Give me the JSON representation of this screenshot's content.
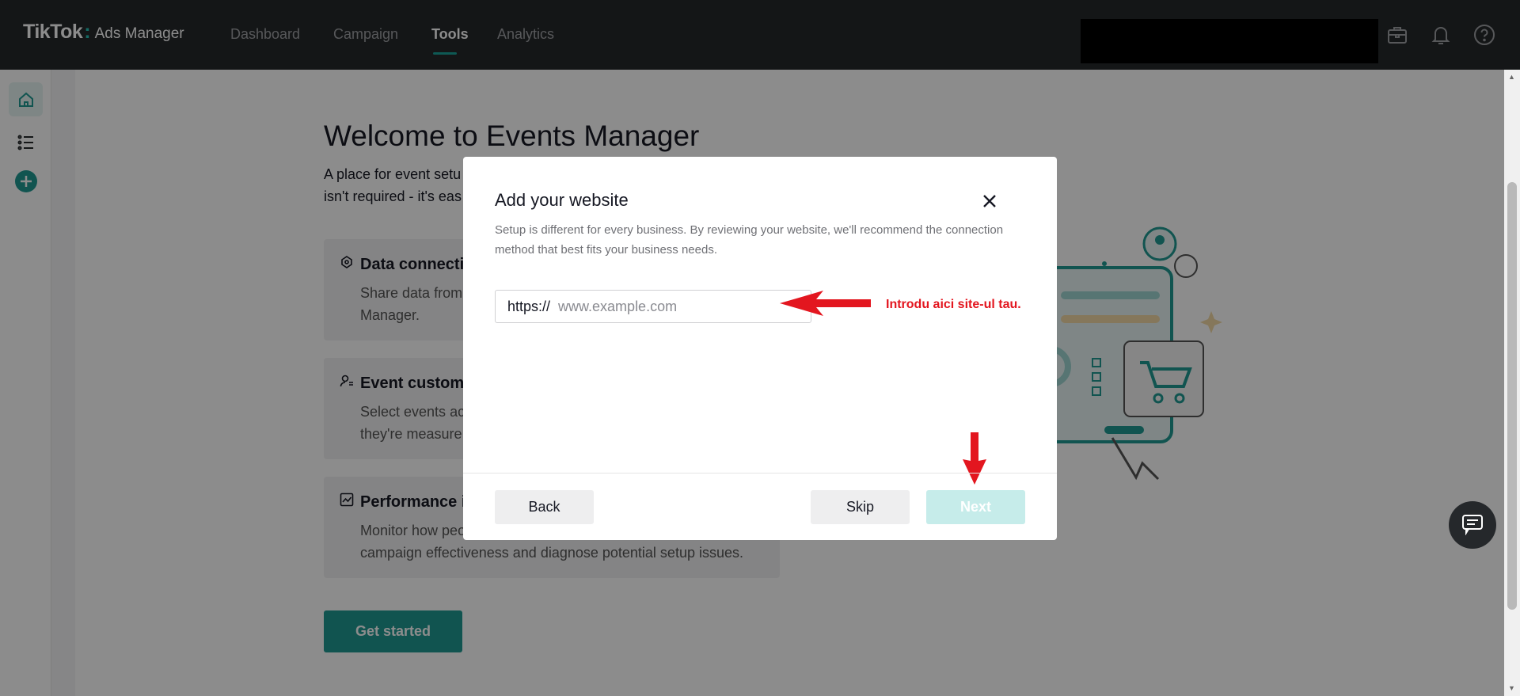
{
  "topbar": {
    "logo_brand": "TikTok",
    "logo_dot": ":",
    "logo_sub": "Ads Manager",
    "nav": [
      {
        "label": "Dashboard"
      },
      {
        "label": "Campaign"
      },
      {
        "label": "Tools",
        "active": true
      },
      {
        "label": "Analytics"
      }
    ],
    "icons": [
      "briefcase-icon",
      "bell-icon",
      "help-icon"
    ]
  },
  "sidebar": {
    "items": [
      "home-icon",
      "list-icon",
      "add-icon"
    ]
  },
  "page": {
    "title": "Welcome to Events Manager",
    "desc_line1": "A place for event setu",
    "desc_line2": "isn't required - it's eas",
    "cards": [
      {
        "title": "Data connecti",
        "line1": "Share data from",
        "line2": "Manager.",
        "icon": "data-connection-icon"
      },
      {
        "title": "Event customi",
        "line1": "Select events ac",
        "line2": "they're measure",
        "icon": "user-settings-icon"
      },
      {
        "title": "Performance i",
        "line1": "Monitor how peo",
        "line2": "campaign effectiveness and diagnose potential setup issues.",
        "icon": "trend-chart-icon"
      }
    ],
    "get_started": "Get started"
  },
  "modal": {
    "title": "Add your website",
    "description": "Setup is different for every business. By reviewing your website, we'll recommend the connection method that best fits your business needs.",
    "url_prefix": "https://",
    "url_placeholder": "www.example.com",
    "url_value": "",
    "annotation": "Introdu aici site-ul tau.",
    "back_label": "Back",
    "skip_label": "Skip",
    "next_label": "Next"
  },
  "colors": {
    "accent": "#1f9a93",
    "annotation_red": "#e3161f",
    "topbar_bg": "#25282b",
    "next_disabled": "#c6ecea"
  }
}
